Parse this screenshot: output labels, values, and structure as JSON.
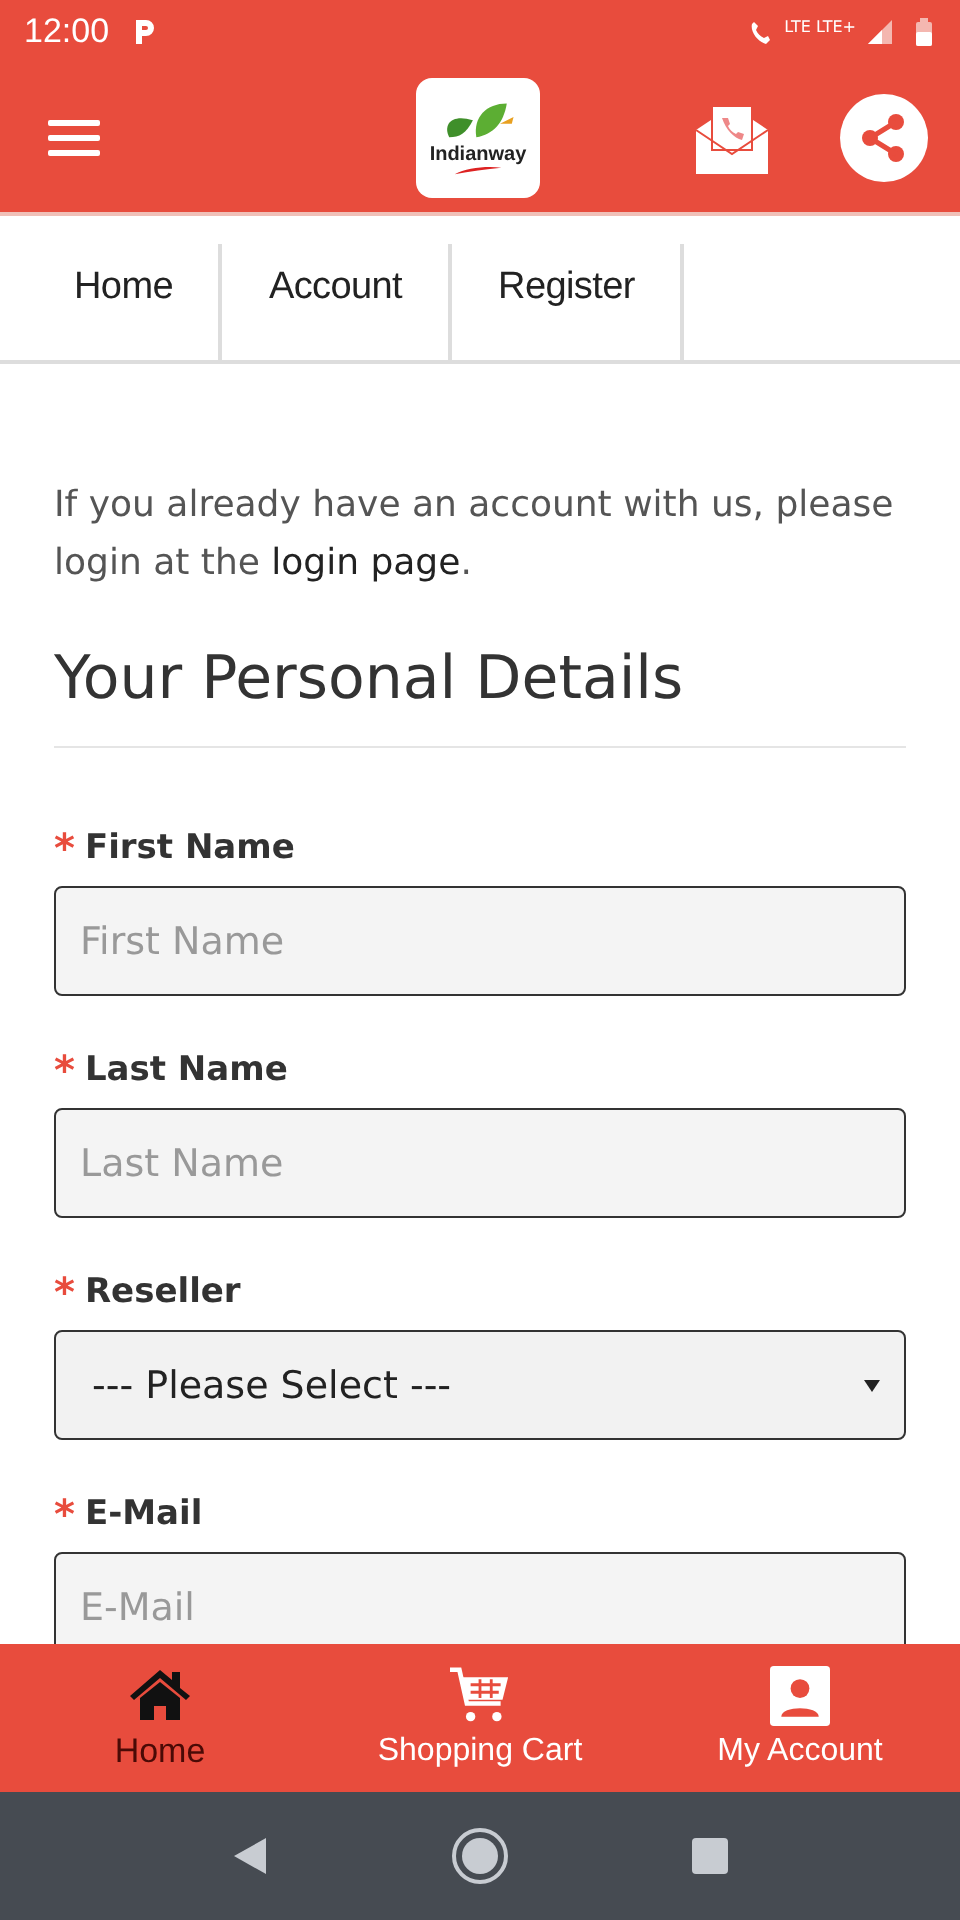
{
  "status_bar": {
    "time": "12:00",
    "network": "LTE LTE+"
  },
  "header": {
    "logo_text": "Indianway"
  },
  "breadcrumb": [
    "Home",
    "Account",
    "Register"
  ],
  "intro": {
    "text": "If you already have an account with us, please login at the ",
    "link": "login page",
    "end": "."
  },
  "section_title": "Your Personal Details",
  "fields": [
    {
      "label": "First Name",
      "marker": "*",
      "kind": "text",
      "placeholder": "First Name"
    },
    {
      "label": "Last Name",
      "marker": "*",
      "kind": "text",
      "placeholder": "Last Name"
    },
    {
      "label": "Reseller",
      "marker": "*",
      "kind": "select",
      "value": "--- Please Select ---"
    },
    {
      "label": "E-Mail",
      "marker": "*",
      "kind": "text",
      "placeholder": "E-Mail"
    }
  ],
  "bottom_nav": [
    {
      "label": "Home",
      "kind": "home",
      "selected": true
    },
    {
      "label": "Shopping Cart",
      "kind": "cart",
      "selected": false
    },
    {
      "label": "My Account",
      "kind": "account",
      "selected": false
    }
  ]
}
